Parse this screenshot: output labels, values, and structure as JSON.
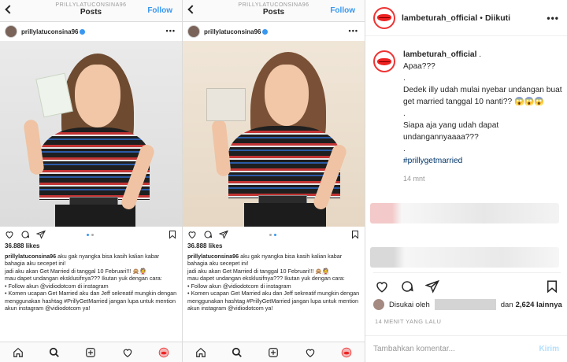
{
  "phone1": {
    "account": "PRILLYLATUCONSINA96",
    "title": "Posts",
    "follow": "Follow",
    "username": "prillylatuconsina96",
    "likes": "36.888 likes",
    "caption_user": "prillylatuconsina96",
    "caption_lines": [
      "aku gak nyangka bisa kasih kalian kabar bahagia aku secepet ini!",
      "jadi aku akan Get Married di tanggal 10 Februari!!! 🙊👰",
      "mau dapet undangan eksklusifnya??? Ikutan yuk dengan cara:",
      "• Follow akun @vidiodotcom di instagram",
      "• Komen ucapan Get Married aku dan Jeff sekreatif mungkin dengan menggunakan hashtag #PrillyGetMarried jangan lupa untuk mention akun instagram @vidiodotcom ya!"
    ]
  },
  "phone2": {
    "account": "PRILLYLATUCONSINA96",
    "title": "Posts",
    "follow": "Follow",
    "username": "prillylatuconsina96",
    "likes": "36.888 likes",
    "caption_user": "prillylatuconsina96",
    "caption_lines": [
      "aku gak nyangka bisa kasih kalian kabar bahagia aku secepet ini!",
      "jadi aku akan Get Married di tanggal 10 Februari!!! 🙊👰",
      "mau dapet undangan eksklusifnya??? Ikutan yuk dengan cara:",
      "• Follow akun @vidiodotcom di instagram",
      "• Komen ucapan Get Married aku dan Jeff sekreatif mungkin dengan menggunakan hashtag #PrillyGetMarried jangan lupa untuk mention akun instagram @vidiodotcom ya!"
    ]
  },
  "desktop": {
    "username": "lambeturah_official",
    "separator": "•",
    "follow_state": "Diikuti",
    "caption_user": "lambeturah_official",
    "caption_lines": [
      ".",
      "Apaa???",
      ".",
      "Dedek illy udah mulai nyebar undangan buat get married tanggal 10 nanti?? 😱😱😱",
      ".",
      "Siapa aja yang udah dapat undangannyaaaa???",
      "."
    ],
    "hashtag": "#prillygetmarried",
    "time": "14 mnt",
    "liked_by_prefix": "Disukai oleh",
    "liked_by_suffix": "dan",
    "liked_count": "2,624 lainnya",
    "posted_ago": "14 MENIT YANG LALU",
    "comment_placeholder": "Tambahkan komentar...",
    "send_label": "Kirim"
  },
  "colors": {
    "link": "#003569",
    "follow_blue": "#3897f0",
    "border": "#dbdbdb",
    "lips_red": "#e22222"
  },
  "icons": [
    "chevron-left-icon",
    "more-icon",
    "heart-icon",
    "comment-icon",
    "send-icon",
    "bookmark-icon",
    "home-icon",
    "search-icon",
    "add-icon",
    "activity-icon",
    "profile-icon",
    "verified-icon"
  ]
}
